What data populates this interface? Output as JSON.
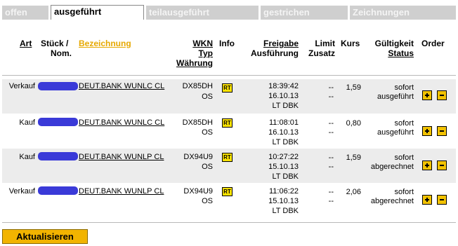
{
  "tabs": [
    "offen",
    "ausgeführt",
    "teilausgeführt",
    "gestrichen",
    "Zeichnungen"
  ],
  "active_tab": "ausgeführt",
  "header": {
    "art": "Art",
    "stueck": "Stück /",
    "nom": "Nom.",
    "bezeichnung": "Bezeichnung",
    "wkn": "WKN",
    "typ": "Typ",
    "waehrung": "Währung",
    "info": "Info",
    "freigabe": "Freigabe",
    "ausfuehrung": "Ausführung",
    "limit": "Limit",
    "zusatz": "Zusatz",
    "kurs": "Kurs",
    "gueltigkeit": "Gültigkeit",
    "status": "Status",
    "order": "Order"
  },
  "rows": [
    {
      "art": "Verkauf",
      "name": "DEUT.BANK WUNLC CL",
      "wkn": "DX85DH",
      "typ": "OS",
      "info": "RT",
      "time": "18:39:42",
      "date": "16.10.13",
      "venue": "LT DBK",
      "limit": "--",
      "zusatz": "--",
      "kurs": "1,59",
      "gueltigkeit": "sofort",
      "status": "ausgeführt"
    },
    {
      "art": "Kauf",
      "name": "DEUT.BANK WUNLC CL",
      "wkn": "DX85DH",
      "typ": "OS",
      "info": "RT",
      "time": "11:08:01",
      "date": "16.10.13",
      "venue": "LT DBK",
      "limit": "--",
      "zusatz": "--",
      "kurs": "0,80",
      "gueltigkeit": "sofort",
      "status": "ausgeführt"
    },
    {
      "art": "Kauf",
      "name": "DEUT.BANK WUNLP CL",
      "wkn": "DX94U9",
      "typ": "OS",
      "info": "RT",
      "time": "10:27:22",
      "date": "15.10.13",
      "venue": "LT DBK",
      "limit": "--",
      "zusatz": "--",
      "kurs": "1,59",
      "gueltigkeit": "sofort",
      "status": "abgerechnet"
    },
    {
      "art": "Verkauf",
      "name": "DEUT.BANK WUNLP CL",
      "wkn": "DX94U9",
      "typ": "OS",
      "info": "RT",
      "time": "11:06:22",
      "date": "15.10.13",
      "venue": "LT DBK",
      "limit": "--",
      "zusatz": "--",
      "kurs": "2,06",
      "gueltigkeit": "sofort",
      "status": "abgerechnet"
    }
  ],
  "refresh_label": "Aktualisieren"
}
